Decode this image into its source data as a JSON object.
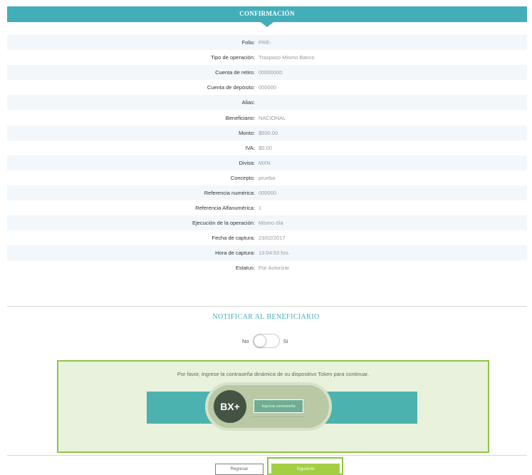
{
  "header": {
    "title": "CONFIRMACIÓN"
  },
  "details": [
    {
      "label": "Folio:",
      "value": "PRE-"
    },
    {
      "label": "Tipo de operación:",
      "value": "Traspaso Mismo Banco"
    },
    {
      "label": "Cuenta de retiro:",
      "value": "00000000"
    },
    {
      "label": "Cuenta de depósito:",
      "value": "000000"
    },
    {
      "label": "Alias:",
      "value": ""
    },
    {
      "label": "Beneficiario:",
      "value": "NACIONAL"
    },
    {
      "label": "Monto:",
      "value": "$500.00"
    },
    {
      "label": "IVA:",
      "value": "$0.00"
    },
    {
      "label": "Divisa:",
      "value": "MXN"
    },
    {
      "label": "Concepto:",
      "value": "prueba"
    },
    {
      "label": "Referencia numérica:",
      "value": "000000"
    },
    {
      "label": "Referencia Alfanumérica:",
      "value": "1"
    },
    {
      "label": "Ejecución de la operación:",
      "value": "Mismo día"
    },
    {
      "label": "Fecha de captura:",
      "value": "23/02/2017"
    },
    {
      "label": "Hora de captura:",
      "value": "13:04:53 hrs."
    },
    {
      "label": "Estatus:",
      "value": "Por Autorizar"
    }
  ],
  "notify": {
    "title": "NOTIFICAR AL BENEFICIARIO",
    "no_label": "No",
    "yes_label": "Sí",
    "enabled": false
  },
  "token": {
    "message": "Por favor, ingrese la contraseña dinámica de su dispositivo Token para continuar.",
    "logo_text": "BX+",
    "input_placeholder": "Ingresa contraseña"
  },
  "buttons": {
    "back": "Regresar",
    "next": "Siguiente"
  },
  "colors": {
    "accent": "#43aeb9",
    "green": "#8cc63f",
    "next_button": "#a4cf45",
    "token_band": "#4cb2b0",
    "logo": "#435444"
  }
}
